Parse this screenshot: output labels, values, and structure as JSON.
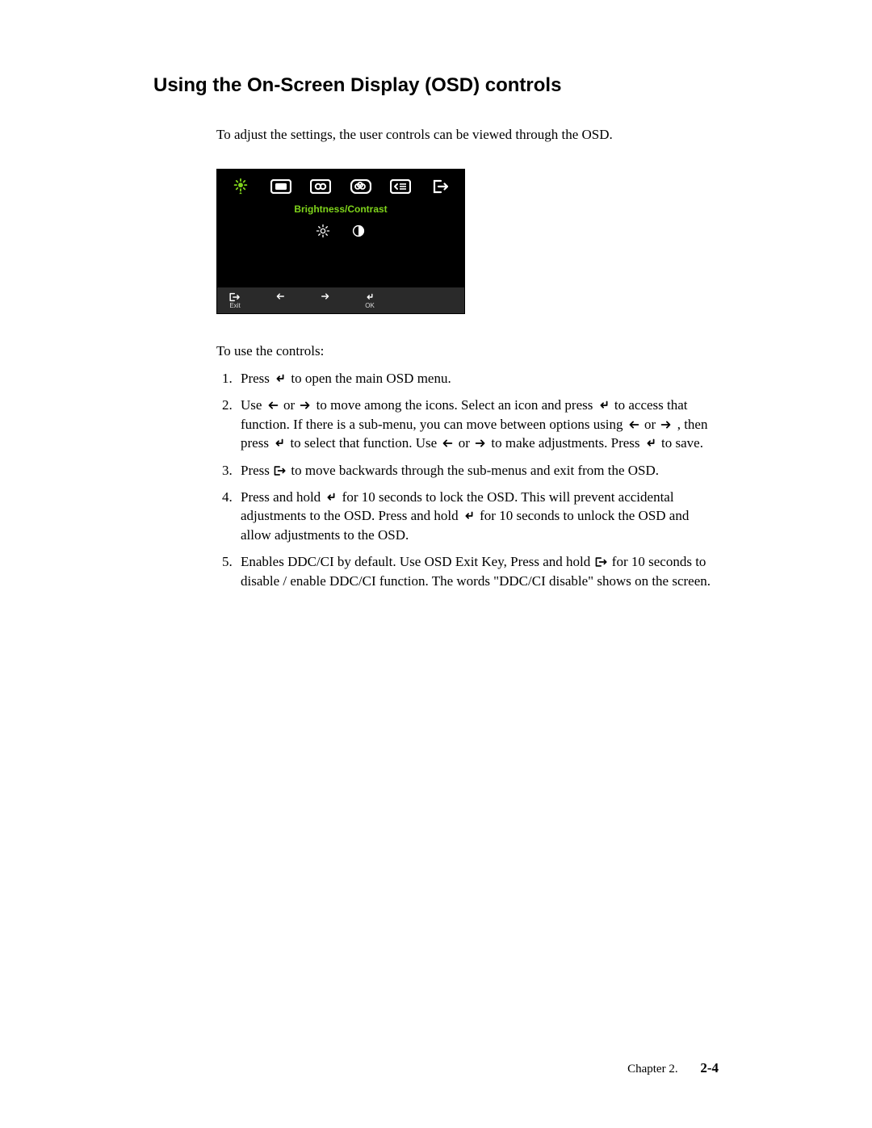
{
  "title": "Using the On-Screen Display (OSD) controls",
  "intro": "To adjust the settings,  the user controls can be viewed through the OSD.",
  "osd": {
    "menu_label": "Brightness/Contrast",
    "exit_label": "Exit",
    "ok_label": "OK"
  },
  "lead": "To use the controls:",
  "steps": {
    "s1a": "Press ",
    "s1b": " to open the main OSD menu.",
    "s2a": "Use ",
    "s2b": " or ",
    "s2c": " to move among the icons. Select an icon and press ",
    "s2d": " to access that function. If there is a sub-menu, you can move between options using ",
    "s2e": " or ",
    "s2f": " , then press ",
    "s2g": " to select that function. Use ",
    "s2h": " or ",
    "s2i": " to make adjustments. Press ",
    "s2j": " to save.",
    "s3a": "Press ",
    "s3b": " to move backwards through the sub-menus and exit from the OSD.",
    "s4a": "Press and hold  ",
    "s4b": "  for 10 seconds to lock the OSD. This will prevent accidental adjustments to the OSD. Press and hold ",
    "s4c": "  for 10 seconds to unlock the OSD and allow adjustments to the OSD.",
    "s5a": "Enables DDC/CI by default. Use OSD Exit Key,  Press and hold ",
    "s5b": " for 10 seconds to disable / enable DDC/CI function. The words \"DDC/CI disable\" shows on the screen."
  },
  "footer": {
    "chapter": "Chapter 2.",
    "page": "2-4"
  }
}
